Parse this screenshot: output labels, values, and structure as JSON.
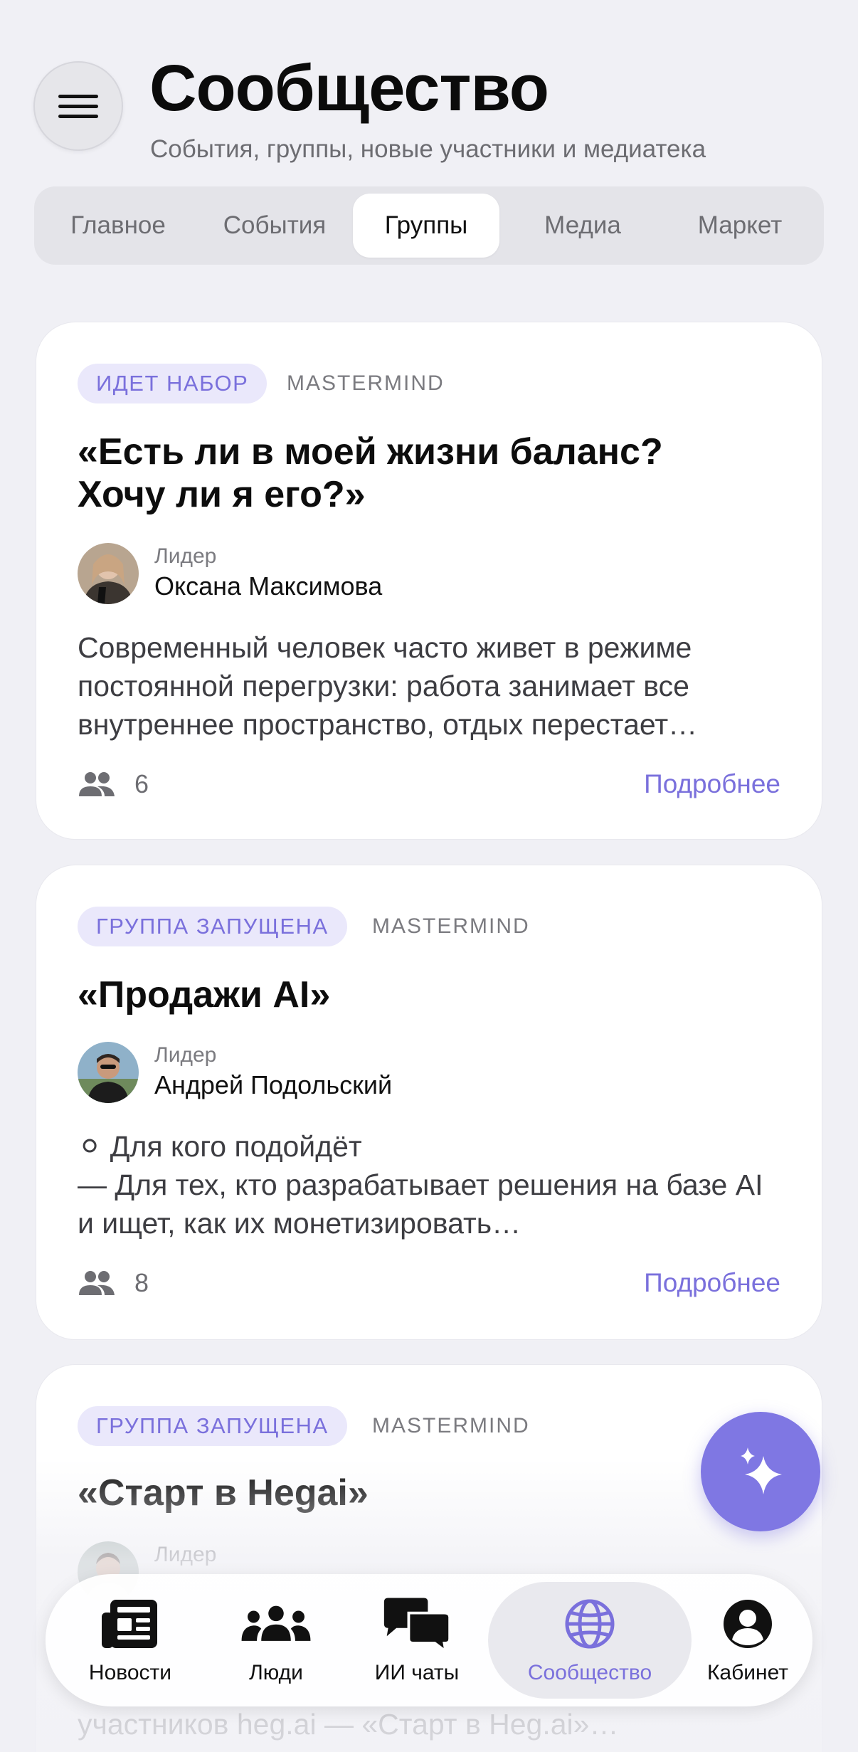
{
  "header": {
    "title": "Сообщество",
    "subtitle": "События, группы, новые участники и медиатека"
  },
  "tabs": [
    {
      "label": "Главное",
      "active": false
    },
    {
      "label": "События",
      "active": false
    },
    {
      "label": "Группы",
      "active": true
    },
    {
      "label": "Медиа",
      "active": false
    },
    {
      "label": "Маркет",
      "active": false
    }
  ],
  "cards": [
    {
      "badge": "ИДЕТ НАБОР",
      "kind": "MASTERMIND",
      "title": "«Есть ли в моей жизни баланс? Хочу ли я его?»",
      "leader_label": "Лидер",
      "leader_name": "Оксана Максимова",
      "description": "Современный человек часто живет в режиме постоянной перегрузки: работа занимает все внутреннее пространство, отдых перестает…",
      "members": "6",
      "more": "Подробнее"
    },
    {
      "badge": "ГРУППА ЗАПУЩЕНА",
      "kind": "MASTERMIND",
      "title": "«Продажи AI»",
      "leader_label": "Лидер",
      "leader_name": "Андрей Подольский",
      "description_line1": "⚪ Для кого подойдёт",
      "description_rest": "— Для тех, кто разрабатывает решения на базе AI и ищет, как их монетизировать…",
      "members": "8",
      "more": "Подробнее"
    },
    {
      "badge": "ГРУППА ЗАПУЩЕНА",
      "kind": "MASTERMIND",
      "title": "«Старт в Hegai»",
      "leader_label": "Лидер",
      "description_tail": "участников heg.ai — «Старт в Heg.ai»…"
    }
  ],
  "bottom_nav": [
    {
      "label": "Новости",
      "icon": "newspaper-icon",
      "active": false
    },
    {
      "label": "Люди",
      "icon": "people-icon",
      "active": false
    },
    {
      "label": "ИИ чаты",
      "icon": "chat-bubbles-icon",
      "active": false
    },
    {
      "label": "Сообщество",
      "icon": "globe-icon",
      "active": true
    },
    {
      "label": "Кабинет",
      "icon": "profile-icon",
      "active": false
    }
  ],
  "fab": {
    "icon": "sparkles-icon"
  },
  "colors": {
    "accent": "#7a70dc",
    "badge_bg": "#eae8fb",
    "background": "#f0f0f5"
  }
}
